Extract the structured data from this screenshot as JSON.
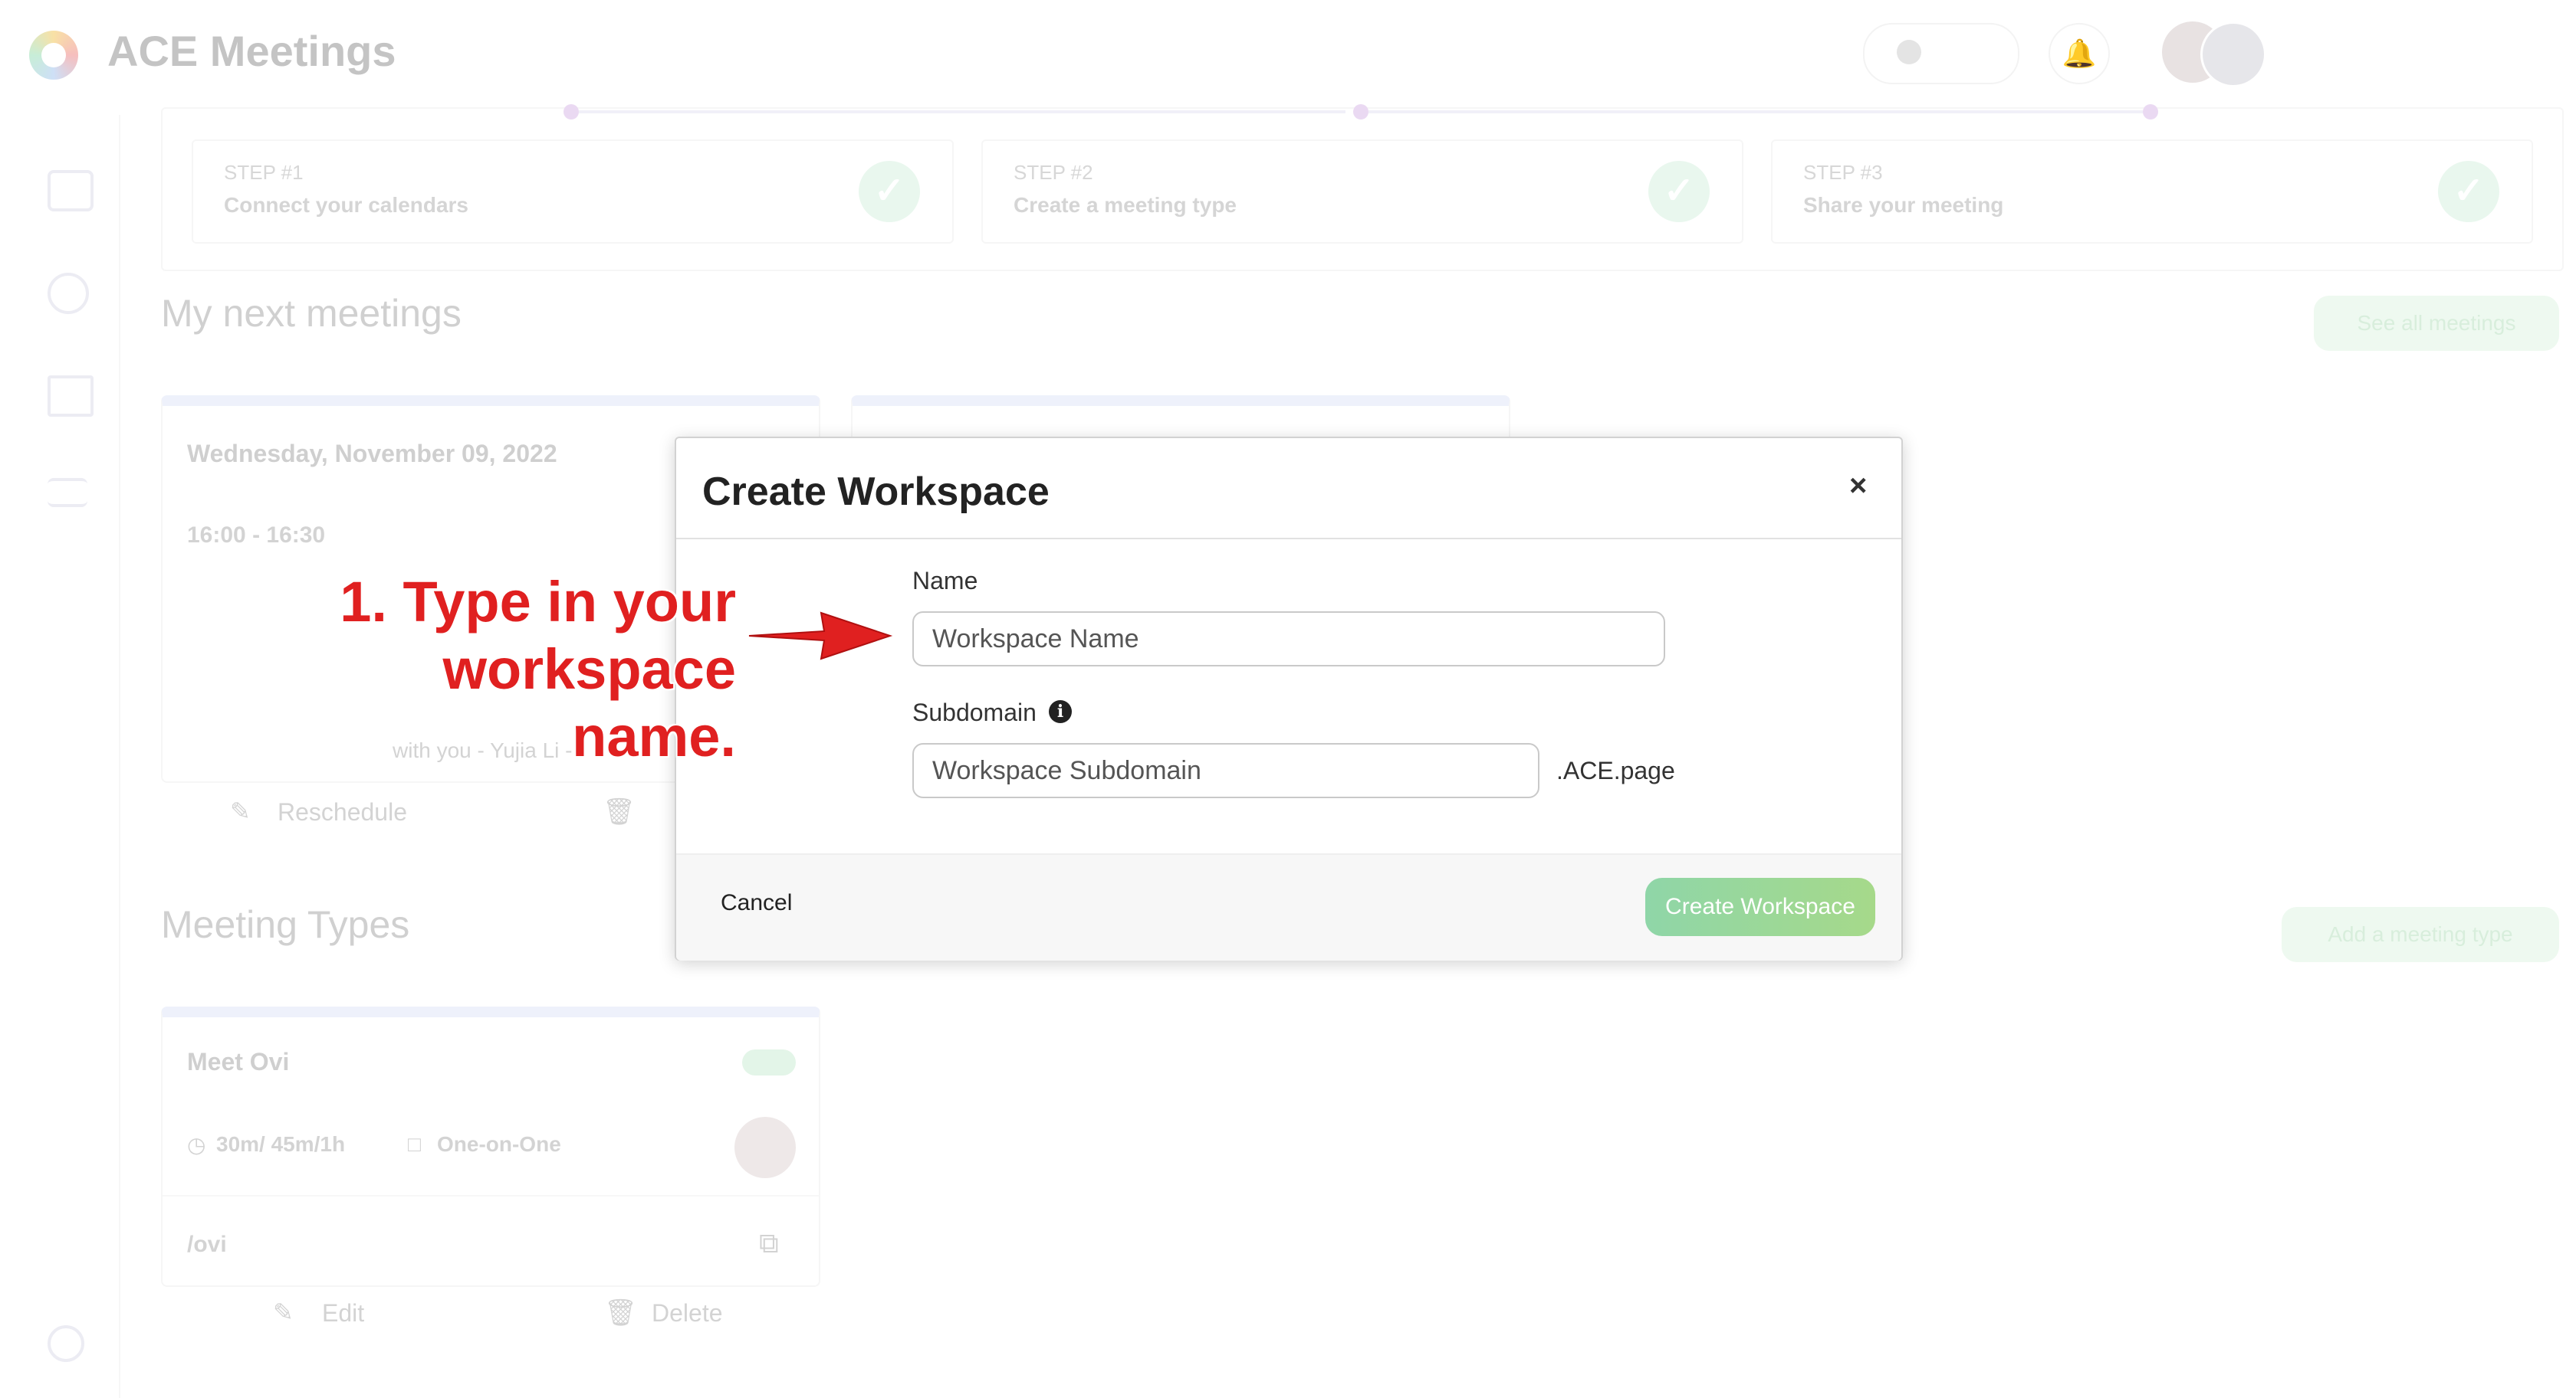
{
  "app": {
    "title": "ACE Meetings"
  },
  "steps": [
    {
      "label": "STEP #1",
      "title": "Connect your calendars"
    },
    {
      "label": "STEP #2",
      "title": "Create a meeting type"
    },
    {
      "label": "STEP #3",
      "title": "Share your meeting"
    }
  ],
  "next_meetings": {
    "title": "My next meetings",
    "see_all": "See all meetings",
    "card": {
      "date": "Wednesday, November 09, 2022",
      "time": "16:00 - 16:30",
      "with": "with you - Yujia Li -",
      "reschedule": "Reschedule"
    }
  },
  "meeting_types": {
    "title": "Meeting Types",
    "add": "Add a meeting type",
    "card": {
      "name": "Meet Ovi",
      "durations": "30m/ 45m/1h",
      "kind": "One-on-One",
      "slug": "/ovi",
      "edit": "Edit",
      "delete": "Delete"
    }
  },
  "modal": {
    "title": "Create Workspace",
    "close": "×",
    "name_label": "Name",
    "name_placeholder": "Workspace Name",
    "subdomain_label": "Subdomain",
    "subdomain_placeholder": "Workspace Subdomain",
    "subdomain_suffix": ".ACE.page",
    "cancel": "Cancel",
    "create": "Create Workspace"
  },
  "annotation": {
    "line1": "1. Type in your",
    "line2": "workspace name."
  },
  "colors": {
    "accent_green": "#8fd6a8",
    "annotation_red": "#e02020"
  }
}
